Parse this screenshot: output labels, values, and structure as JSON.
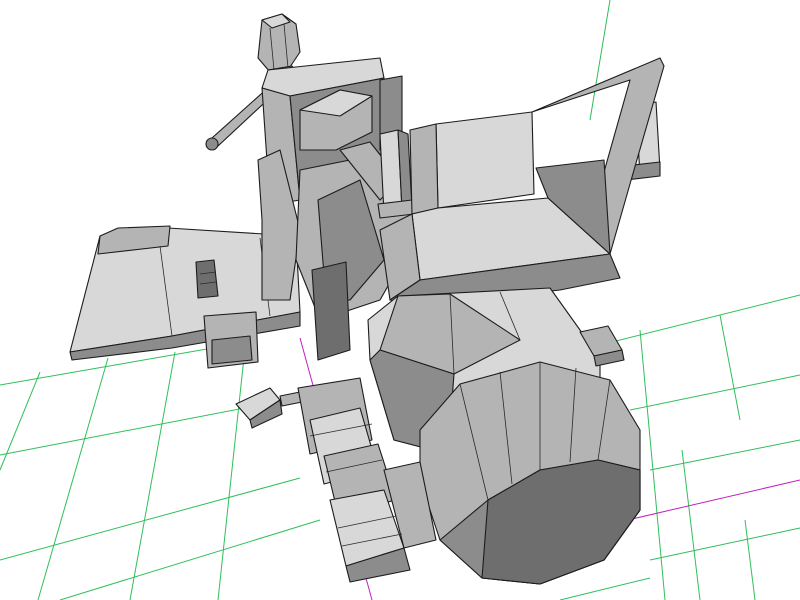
{
  "viewport": {
    "background_color": "#ffffff",
    "grid_color": "#2fbf5a",
    "axis_color": "#c020c0",
    "shade_light": "#d8d8d8",
    "shade_mid": "#b4b4b4",
    "shade_dark": "#8c8c8c",
    "shade_darker": "#6e6e6e"
  }
}
